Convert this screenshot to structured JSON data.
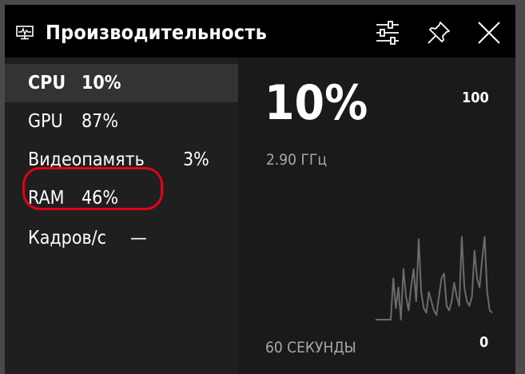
{
  "window": {
    "title": "Производительность",
    "icon": "performance-monitor-icon",
    "buttons": {
      "settings": "settings-sliders-icon",
      "pin": "pin-icon",
      "close": "close-icon"
    }
  },
  "sidebar": {
    "items": [
      {
        "label": "CPU",
        "value": "10%",
        "active": true
      },
      {
        "label": "GPU",
        "value": "87%",
        "active": false
      },
      {
        "label": "Видеопамять",
        "value": "3%",
        "active": false
      },
      {
        "label": "RAM",
        "value": "46%",
        "active": false
      },
      {
        "label": "Кадров/с",
        "value": "—",
        "active": false,
        "highlighted": true
      }
    ]
  },
  "detail": {
    "value": "10%",
    "frequency": "2.90 ГГц",
    "y_max": "100",
    "y_min": "0",
    "x_label": "60 СЕКУНДЫ"
  },
  "chart_data": {
    "type": "line",
    "ylim": [
      0,
      100
    ],
    "values": [
      0,
      0,
      0,
      0,
      0,
      0,
      0,
      18,
      5,
      14,
      0,
      22,
      10,
      4,
      14,
      22,
      8,
      35,
      12,
      5,
      3,
      12,
      8,
      4,
      2,
      10,
      18,
      20,
      6,
      4,
      8,
      16,
      10,
      6,
      36,
      14,
      8,
      6,
      10,
      30,
      18,
      14,
      26,
      36,
      12,
      4,
      3
    ]
  },
  "colors": {
    "titlebar": "#000000",
    "sidebar": "#1f1f1f",
    "sidebar_active": "#333333",
    "main": "#1a1a1a",
    "graph_line": "#6b6b6b",
    "annotation": "#e3001b"
  }
}
